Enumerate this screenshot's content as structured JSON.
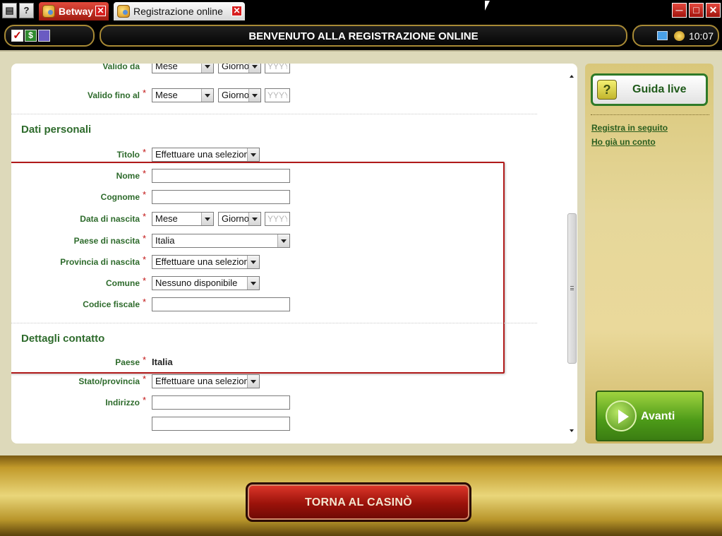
{
  "tabs": [
    {
      "label": "Betway"
    },
    {
      "label": "Registrazione online"
    }
  ],
  "header": {
    "title": "BENVENUTO ALLA REGISTRAZIONE ONLINE",
    "clock": "10:07"
  },
  "form": {
    "valido_da": {
      "label": "Valido da",
      "month": "Mese",
      "day": "Giorno",
      "year_placeholder": "YYYY"
    },
    "valido_fino_al": {
      "label": "Valido fino al",
      "month": "Mese",
      "day": "Giorno",
      "year_placeholder": "YYYY"
    },
    "dati_personali": {
      "title": "Dati personali",
      "titolo": {
        "label": "Titolo",
        "value": "Effettuare una selezione"
      },
      "nome": {
        "label": "Nome",
        "value": ""
      },
      "cognome": {
        "label": "Cognome",
        "value": ""
      },
      "data_di_nascita": {
        "label": "Data di nascita",
        "month": "Mese",
        "day": "Giorno",
        "year_placeholder": "YYYY"
      },
      "paese_di_nascita": {
        "label": "Paese di nascita",
        "value": "Italia"
      },
      "provincia_di_nascita": {
        "label": "Provincia di nascita",
        "value": "Effettuare una selezione"
      },
      "comune": {
        "label": "Comune",
        "value": "Nessuno disponibile"
      },
      "codice_fiscale": {
        "label": "Codice fiscale",
        "value": ""
      }
    },
    "dettagli_contatto": {
      "title": "Dettagli contatto",
      "paese": {
        "label": "Paese",
        "value": "Italia"
      },
      "stato_provincia": {
        "label": "Stato/provincia",
        "value": "Effettuare una selezione"
      },
      "indirizzo": {
        "label": "Indirizzo",
        "value": ""
      }
    },
    "required_mark": "*"
  },
  "sidebar": {
    "guida_live": "Guida live",
    "help_icon": "?",
    "registra_in_seguito": "Registra in seguito",
    "ho_gia_un_conto": "Ho già un conto",
    "avanti": "Avanti"
  },
  "footer": {
    "torna_al_casino": "TORNA AL CASINÒ"
  },
  "icons": [
    "menu-icon",
    "help-icon",
    "checklist-icon",
    "cash-icon",
    "card-icon",
    "network-icon",
    "coins-icon",
    "minimize-icon",
    "maximize-icon",
    "close-icon"
  ],
  "colors": {
    "accent_green": "#2e6b2c",
    "required_red": "#c21515",
    "highlight_red": "#b01a1a",
    "gold": "#d9c77a"
  }
}
